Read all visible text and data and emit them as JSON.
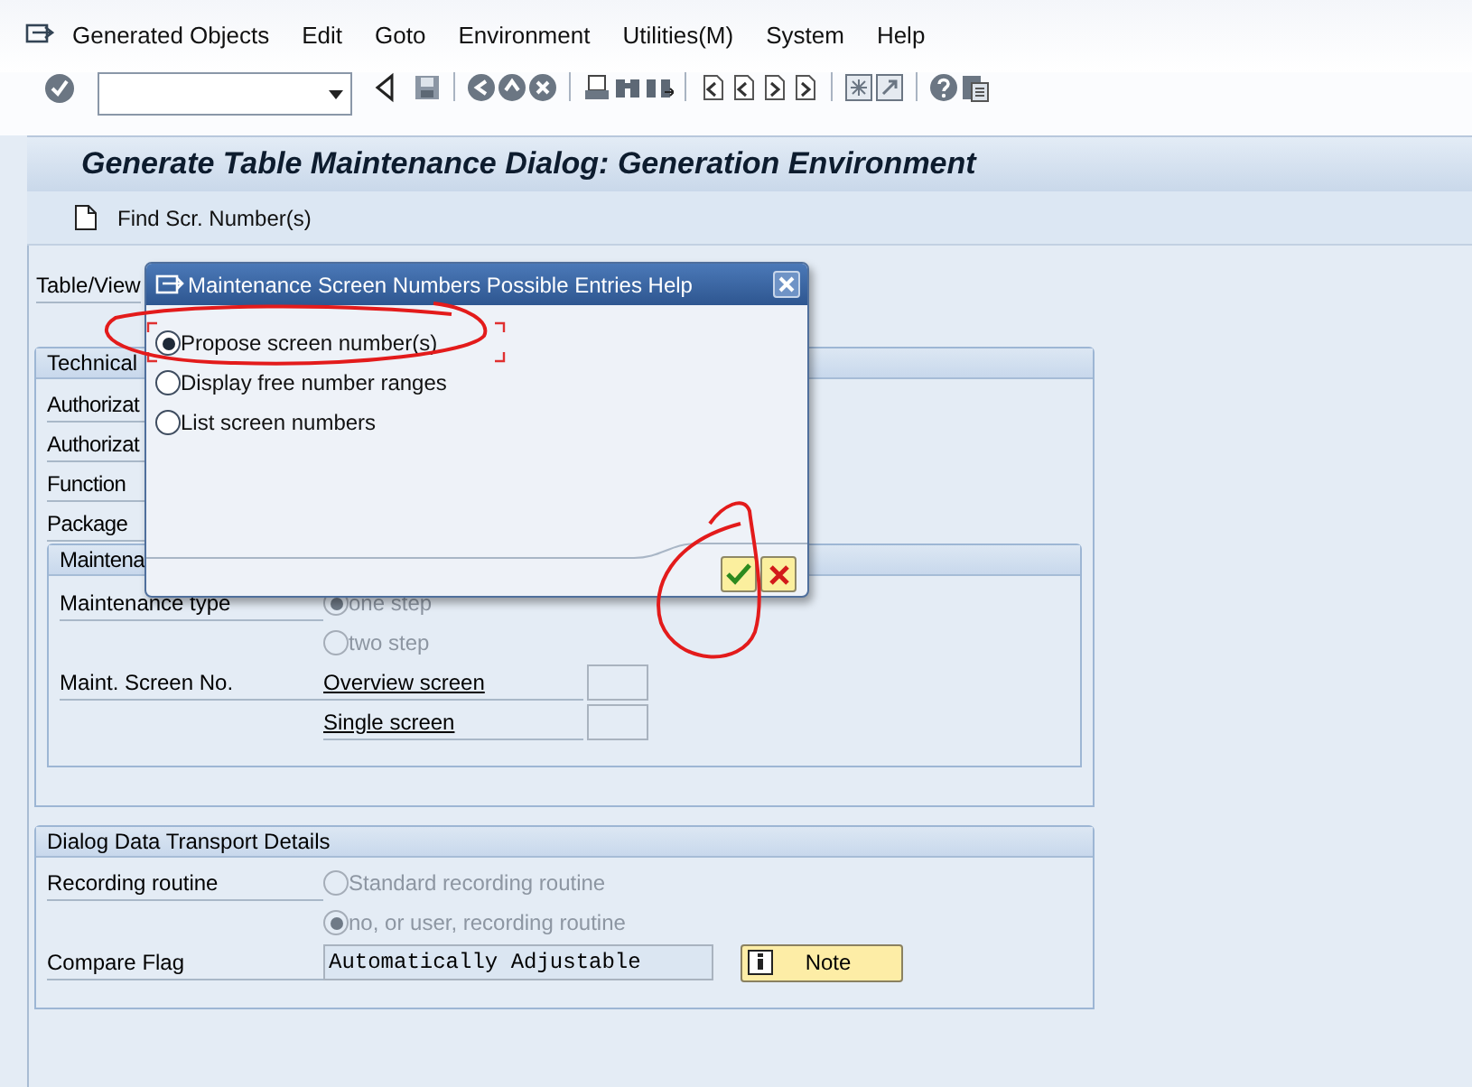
{
  "menu_bar": {
    "items": [
      {
        "label": "Generated Objects"
      },
      {
        "label": "Edit"
      },
      {
        "label": "Goto"
      },
      {
        "label": "Environment"
      },
      {
        "label": "Utilities(M)"
      },
      {
        "label": "System"
      },
      {
        "label": "Help"
      }
    ]
  },
  "title": "Generate Table Maintenance Dialog: Generation Environment",
  "app_toolbar": {
    "buttons": [
      {
        "label": "Find Scr. Number(s)"
      }
    ]
  },
  "form": {
    "table_view_label": "Table/View",
    "technical_group": {
      "title": "Technical",
      "rows": [
        "Authorizat",
        "Authorizat",
        "Function",
        "Package"
      ],
      "maintenance_group": {
        "title": "Maintena",
        "type_label": "Maintenance type",
        "type_options": [
          {
            "label": "one step",
            "selected": true,
            "disabled": true
          },
          {
            "label": "two step",
            "selected": false,
            "disabled": true
          }
        ],
        "screen_label": "Maint. Screen No.",
        "screens": [
          {
            "label": "Overview screen"
          },
          {
            "label": "Single screen"
          }
        ]
      }
    },
    "transport_group": {
      "title": "Dialog Data Transport Details",
      "recording_label": "Recording routine",
      "recording_options": [
        {
          "label": "Standard recording routine",
          "selected": false,
          "disabled": true
        },
        {
          "label": "no, or user, recording routine",
          "selected": true,
          "disabled": true
        }
      ],
      "compare_label": "Compare Flag",
      "compare_value": "Automatically Adjustable",
      "note_button": "Note"
    }
  },
  "dialog": {
    "title": "Maintenance Screen Numbers Possible Entries Help",
    "options": [
      {
        "label": "Propose screen number(s)",
        "selected": true
      },
      {
        "label": "Display free number ranges",
        "selected": false
      },
      {
        "label": "List screen numbers",
        "selected": false
      }
    ]
  }
}
